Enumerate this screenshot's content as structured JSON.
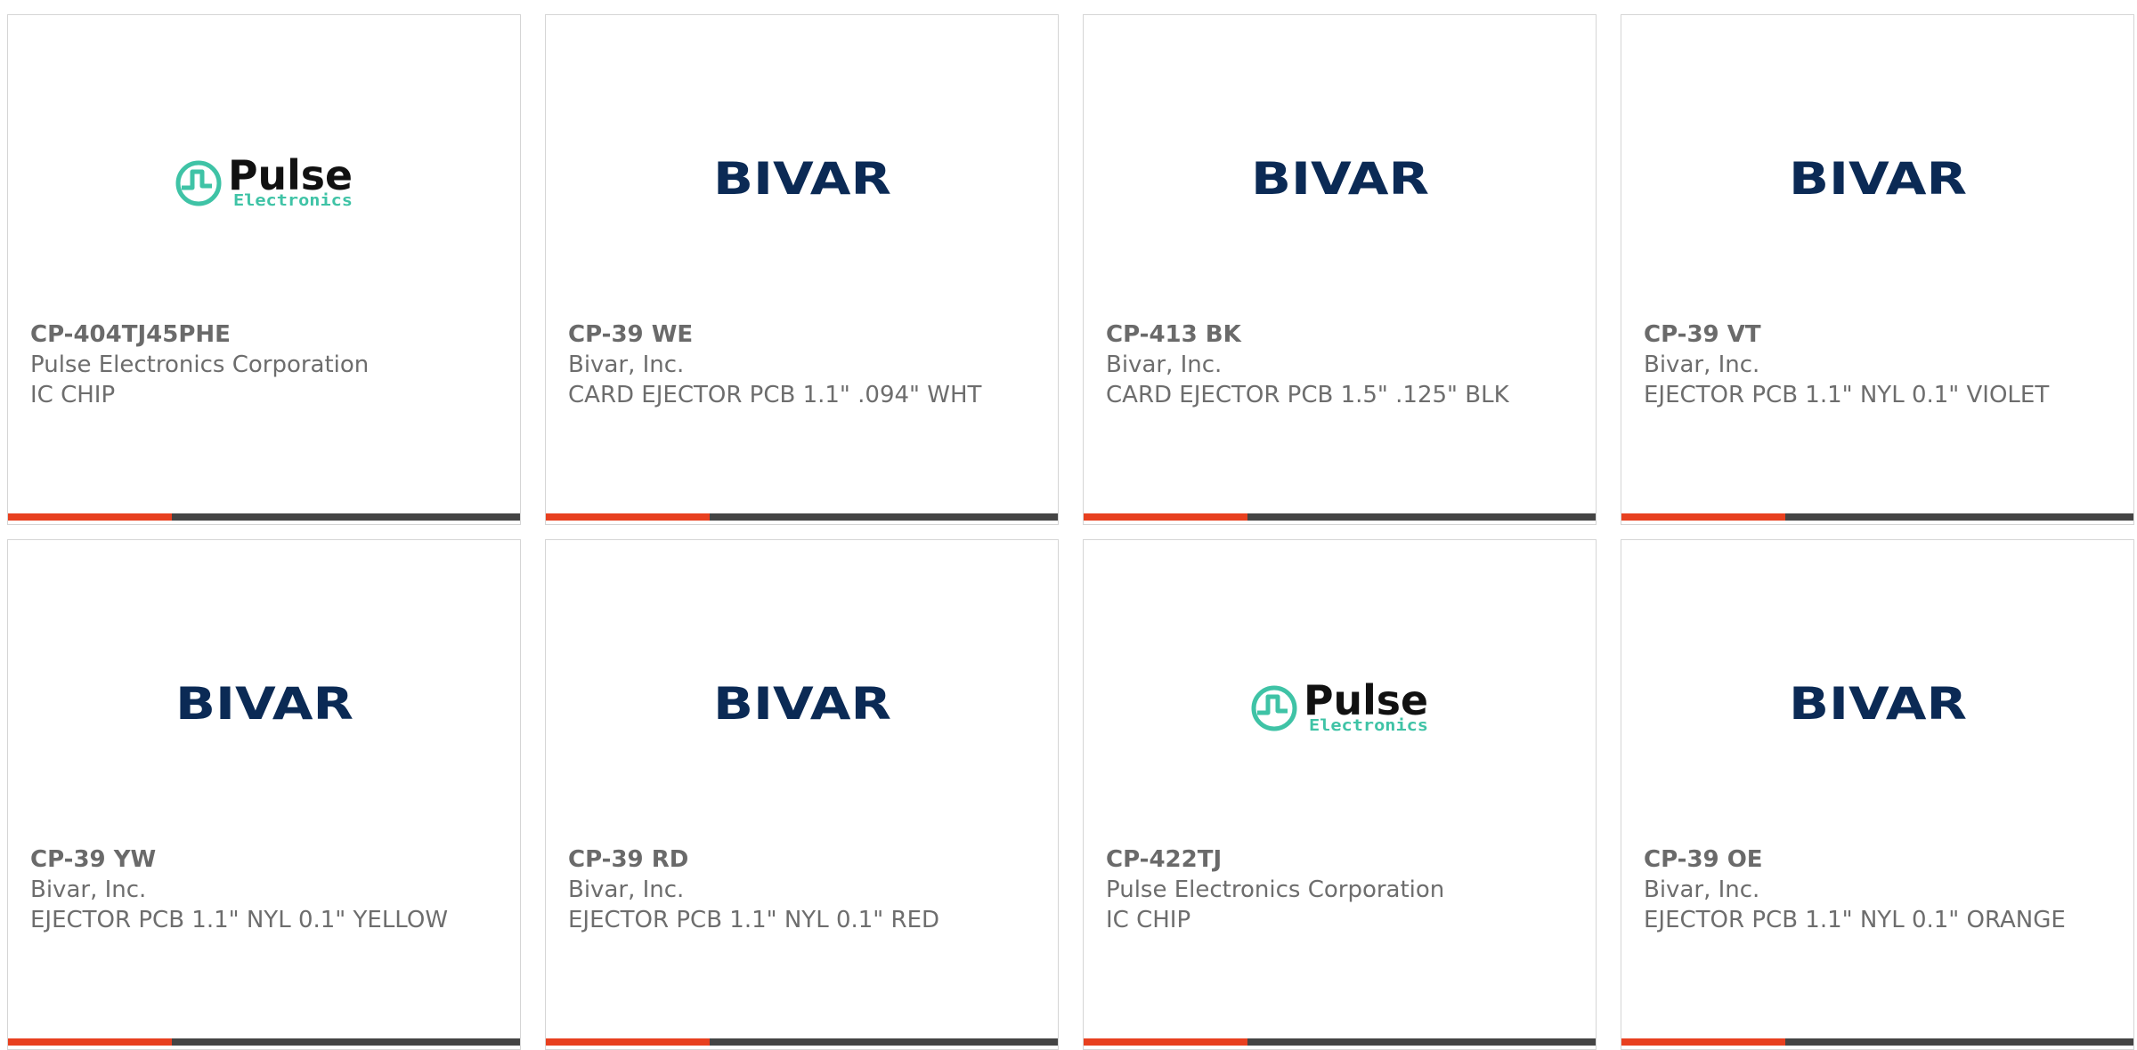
{
  "colors": {
    "accent": "#e8401f",
    "bar_track": "#444444",
    "bivar_navy": "#0b2a55",
    "pulse_teal": "#3fc3a6",
    "text_gray": "#6d6d6d",
    "card_border": "#d5d5d5"
  },
  "accent_fraction": 0.32,
  "products": [
    {
      "part_number": "CP-404TJ45PHE",
      "manufacturer": "Pulse Electronics Corporation",
      "description": "IC CHIP",
      "logo": "pulse",
      "logo_name": "Pulse",
      "logo_sub": "Electronics"
    },
    {
      "part_number": "CP-39 WE",
      "manufacturer": "Bivar, Inc.",
      "description": "CARD EJECTOR PCB 1.1\" .094\" WHT",
      "logo": "bivar",
      "logo_name": "BIVAR"
    },
    {
      "part_number": "CP-413 BK",
      "manufacturer": "Bivar, Inc.",
      "description": "CARD EJECTOR PCB 1.5\" .125\" BLK",
      "logo": "bivar",
      "logo_name": "BIVAR"
    },
    {
      "part_number": "CP-39 VT",
      "manufacturer": "Bivar, Inc.",
      "description": "EJECTOR PCB 1.1\" NYL 0.1\" VIOLET",
      "logo": "bivar",
      "logo_name": "BIVAR"
    },
    {
      "part_number": "CP-39 YW",
      "manufacturer": "Bivar, Inc.",
      "description": "EJECTOR PCB 1.1\" NYL 0.1\" YELLOW",
      "logo": "bivar",
      "logo_name": "BIVAR"
    },
    {
      "part_number": "CP-39 RD",
      "manufacturer": "Bivar, Inc.",
      "description": "EJECTOR PCB 1.1\" NYL 0.1\" RED",
      "logo": "bivar",
      "logo_name": "BIVAR"
    },
    {
      "part_number": "CP-422TJ",
      "manufacturer": "Pulse Electronics Corporation",
      "description": "IC CHIP",
      "logo": "pulse",
      "logo_name": "Pulse",
      "logo_sub": "Electronics"
    },
    {
      "part_number": "CP-39 OE",
      "manufacturer": "Bivar, Inc.",
      "description": "EJECTOR PCB 1.1\" NYL 0.1\" ORANGE",
      "logo": "bivar",
      "logo_name": "BIVAR"
    }
  ]
}
